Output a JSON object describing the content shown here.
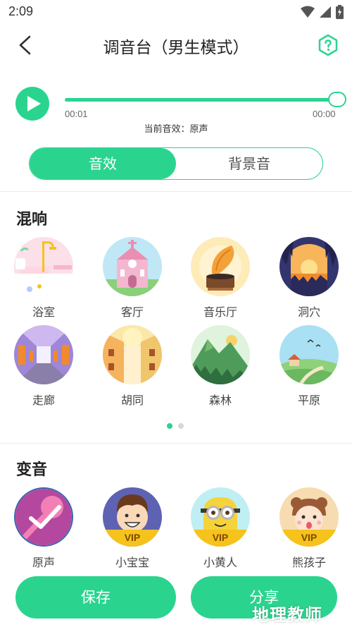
{
  "status": {
    "time": "2:09"
  },
  "header": {
    "title": "调音台（男生模式）"
  },
  "player": {
    "elapsed": "00:01",
    "total": "00:00",
    "current_effect": "当前音效：原声",
    "progress": 1.0
  },
  "tabs": [
    {
      "label": "音效",
      "active": true
    },
    {
      "label": "背景音",
      "active": false
    }
  ],
  "reverb": {
    "title": "混响",
    "items": [
      {
        "label": "浴室",
        "icon": "bathroom-scene"
      },
      {
        "label": "客厅",
        "icon": "church-scene"
      },
      {
        "label": "音乐厅",
        "icon": "gramophone-scene"
      },
      {
        "label": "洞穴",
        "icon": "cave-scene"
      },
      {
        "label": "走廊",
        "icon": "corridor-scene"
      },
      {
        "label": "胡同",
        "icon": "alley-scene"
      },
      {
        "label": "森林",
        "icon": "forest-mountain-scene"
      },
      {
        "label": "平原",
        "icon": "plain-scene"
      }
    ],
    "page_count": 2,
    "active_page": 0
  },
  "voice_change": {
    "title": "变音",
    "items": [
      {
        "label": "原声",
        "icon": "microphone-check-icon",
        "vip": false,
        "selected": true
      },
      {
        "label": "小宝宝",
        "icon": "baby-avatar",
        "vip": true
      },
      {
        "label": "小黄人",
        "icon": "minion-avatar",
        "vip": true
      },
      {
        "label": "熊孩子",
        "icon": "bear-kid-avatar",
        "vip": true
      }
    ],
    "vip_label": "VIP"
  },
  "actions": {
    "save_label": "保存",
    "share_label": "分享"
  },
  "watermark": "地理教师",
  "colors": {
    "accent": "#2ad48f",
    "vip": "#f6c21c"
  }
}
